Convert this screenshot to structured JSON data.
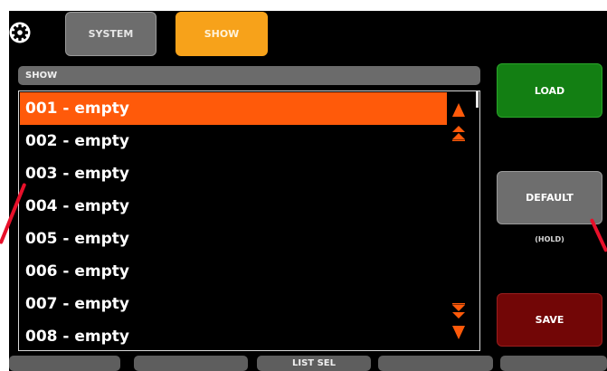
{
  "header": {
    "settings_icon": "gear-icon",
    "tabs": [
      {
        "label": "SYSTEM",
        "active": false
      },
      {
        "label": "SHOW",
        "active": true
      }
    ]
  },
  "section": {
    "label": "SHOW"
  },
  "list": {
    "items": [
      {
        "label": "001 - empty",
        "selected": true
      },
      {
        "label": "002 - empty",
        "selected": false
      },
      {
        "label": "003 - empty",
        "selected": false
      },
      {
        "label": "004 - empty",
        "selected": false
      },
      {
        "label": "005 - empty",
        "selected": false
      },
      {
        "label": "006 - empty",
        "selected": false
      },
      {
        "label": "007 - empty",
        "selected": false
      },
      {
        "label": "008 - empty",
        "selected": false
      }
    ],
    "scroll_icons": [
      "arrow-up-icon",
      "page-up-icon",
      "page-down-icon",
      "arrow-down-icon"
    ]
  },
  "buttons": {
    "load": "LOAD",
    "default": "DEFAULT",
    "default_note": "(HOLD)",
    "save": "SAVE"
  },
  "softkeys": [
    "",
    "",
    "LIST SEL",
    "",
    ""
  ],
  "colors": {
    "accent": "#ff5a0a",
    "tab_active": "#f7a21a",
    "load": "#137f13",
    "save": "#720606",
    "neutral_button": "#6e6e6e",
    "pointer": "#e8102a"
  }
}
